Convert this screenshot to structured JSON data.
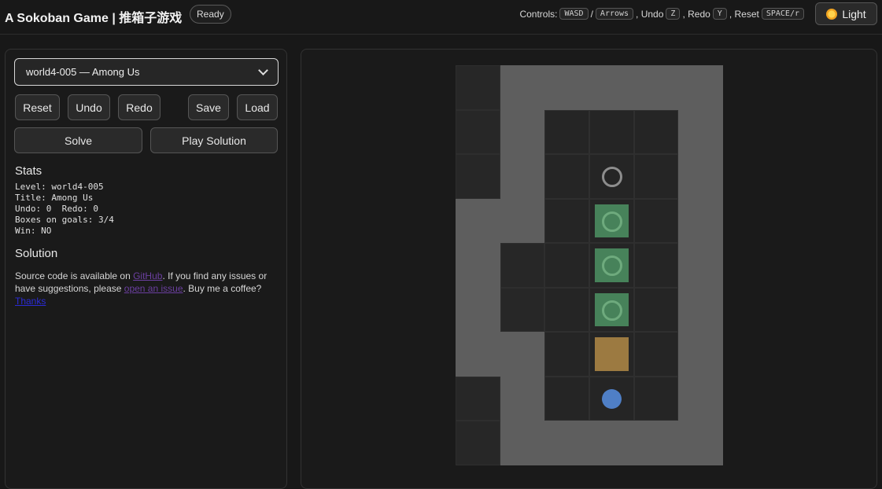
{
  "header": {
    "title": "A Sokoban Game | 推箱子游戏",
    "status": "Ready",
    "controls": {
      "prefix": "Controls:",
      "move_keys": [
        "WASD",
        "Arrows"
      ],
      "undo_label": ", Undo",
      "undo_key": "Z",
      "redo_label": ", Redo",
      "redo_key": "Y",
      "reset_label": ", Reset",
      "reset_key": "SPACE/r"
    },
    "theme_button": {
      "label": "Light",
      "icon": "sun-icon"
    }
  },
  "sidebar": {
    "level_select": {
      "selected": "world4-005 — Among Us"
    },
    "buttons": {
      "reset": "Reset",
      "undo": "Undo",
      "redo": "Redo",
      "save": "Save",
      "load": "Load",
      "solve": "Solve",
      "play_solution": "Play Solution"
    },
    "stats_heading": "Stats",
    "stats": {
      "level_line": "Level: world4-005",
      "title_line": "Title: Among Us",
      "undo_redo_line": "Undo: 0  Redo: 0",
      "boxes_line": "Boxes on goals: 3/4",
      "win_line": "Win: NO"
    },
    "solution_heading": "Solution",
    "footer": {
      "text1": "Source code is available on ",
      "github_link": "GitHub",
      "text2": ". If you find any issues or have suggestions, please ",
      "issue_link": "open an issue",
      "text3": ". Buy me a coffee? ",
      "thanks_link": "Thanks"
    }
  },
  "board": {
    "legend": {
      "o": "outside",
      "#": "wall",
      ".": "floor",
      "g": "goal",
      "B": "box",
      "*": "box-on-goal",
      "@": "player"
    },
    "rows": [
      "o#####",
      "o#...#",
      "o#.g.#",
      "##.*.#",
      "#o.*.#",
      "#o.*.#",
      "##.B.#",
      "o#.@.#",
      "o#####"
    ],
    "colors": {
      "wall": "#5e5e5e",
      "floor": "#252525",
      "box": "#9c7a41",
      "box_on_goal": "#47825a",
      "player": "#4f7fc6",
      "goal": "#8d8d8d"
    }
  }
}
